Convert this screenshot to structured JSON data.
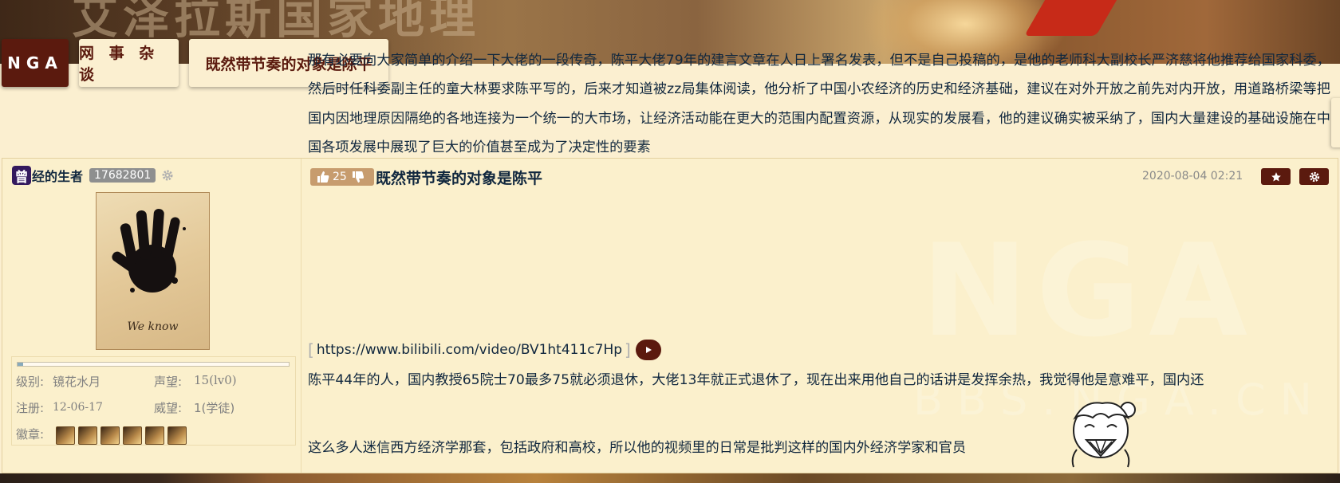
{
  "banner": {
    "background_title": "艾泽拉斯国家地理"
  },
  "nav": {
    "logo": "NGA",
    "forum": "网 事 杂 谈",
    "thread": "既然带节奏的对象是陈平"
  },
  "user": {
    "badge": "曾",
    "name": "经的生者",
    "uid": "17682801",
    "avatar_caption": "We know",
    "progress": 0.02,
    "level_label": "级别:",
    "level_value": "镜花水月",
    "reputation_label": "声望:",
    "reputation_value": "15(lv0)",
    "register_label": "注册:",
    "register_value": "12-06-17",
    "prestige_label": "威望:",
    "prestige_value": "1(学徒)",
    "medals_label": "徽章:",
    "medal_count": 6
  },
  "post": {
    "likes": "25",
    "title": "既然带节奏的对象是陈平",
    "date": "2020-08-04 02:21",
    "paragraph1": "那有必要向大家简单的介绍一下大佬的一段传奇，陈平大佬79年的建言文章在人日上署名发表，但不是自己投稿的，是他的老师科大副校长严济慈将他推荐给国家科委，然后时任科委副主任的童大林要求陈平写的，后来才知道被zz局集体阅读，他分析了中国小农经济的历史和经济基础，建议在对外开放之前先对内开放，用道路桥梁等把国内因地理原因隔绝的各地连接为一个统一的大市场，让经济活动能在更大的范围内配置资源，从现实的发展看，他的建议确实被采纳了，国内大量建设的基础设施在中国各项发展中展现了巨大的价值甚至成为了决定性的要素",
    "link_open": "[",
    "link_url": "https://www.bilibili.com/video/BV1ht411c7Hp",
    "link_close": "]",
    "paragraph2": "陈平44年的人，国内教授65院士70最多75就必须退休，大佬13年就正式退休了，现在出来用他自己的话讲是发挥余热，我觉得他是意难平，国内还",
    "paragraph3": "这么多人迷信西方经济学那套，包括政府和高校，所以他的视频里的日常是批判这样的国内外经济学家和官员"
  },
  "colors": {
    "brown": "#5b1a0e",
    "page_bg": "#fbefd0",
    "text": "#10273e",
    "like_pill": "#c79c6e",
    "uid_badge": "#8e8f8f"
  }
}
